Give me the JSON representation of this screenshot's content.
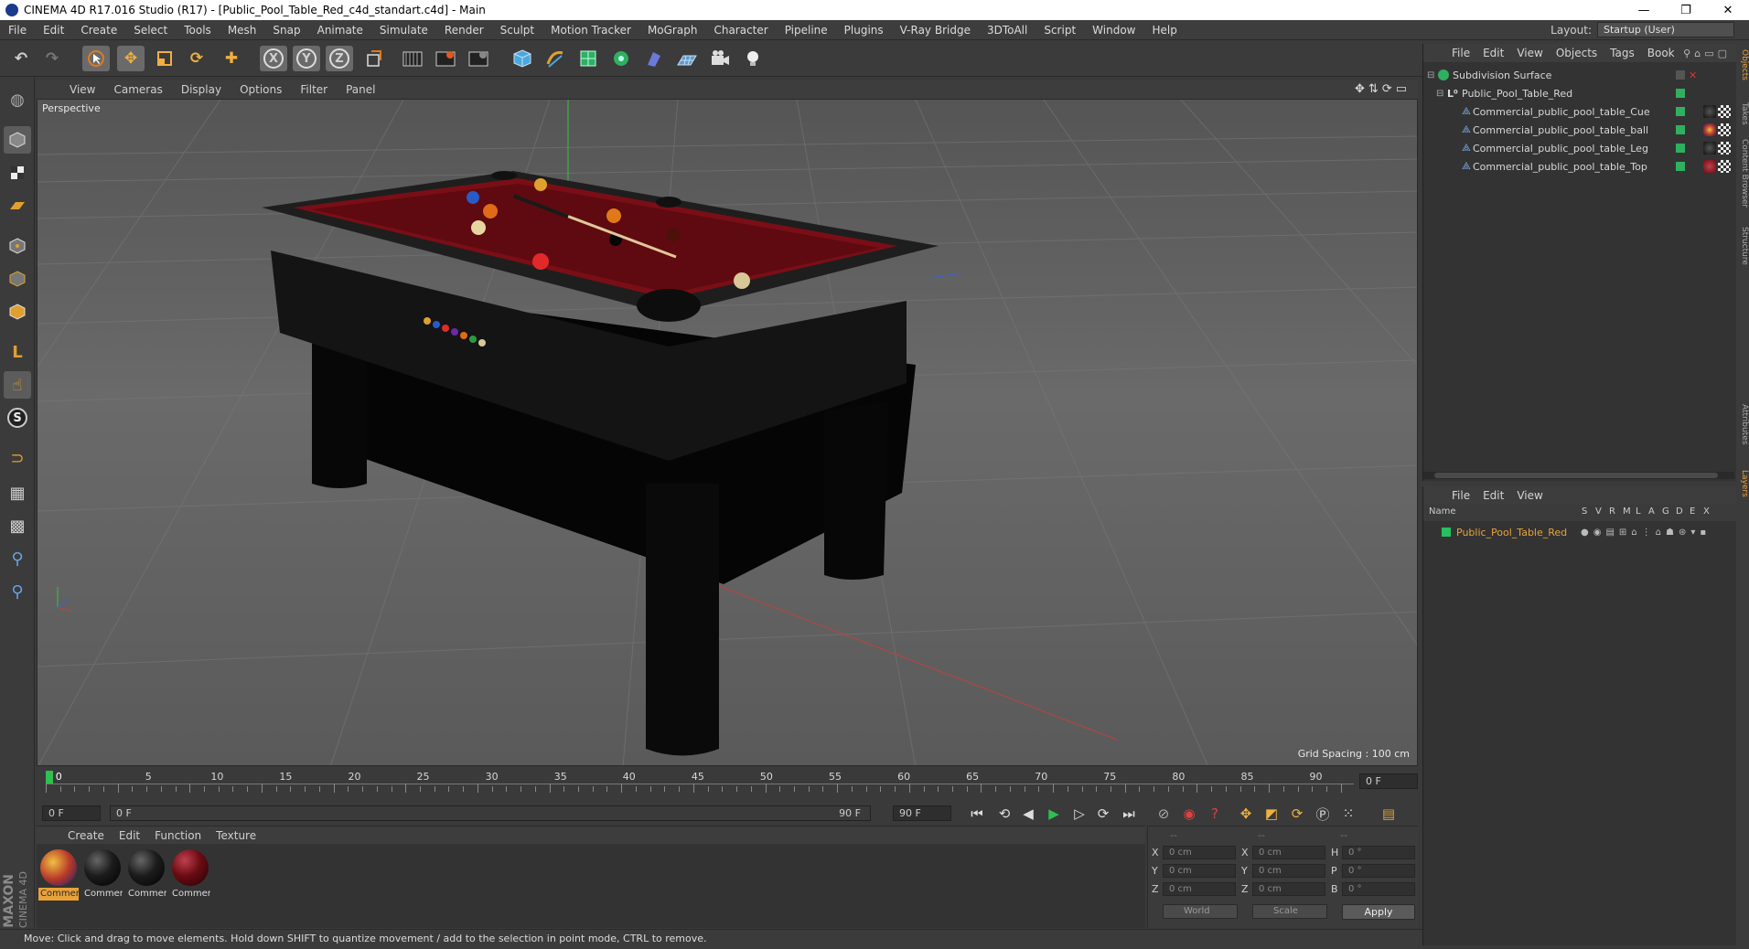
{
  "window": {
    "title": "CINEMA 4D R17.016 Studio (R17) - [Public_Pool_Table_Red_c4d_standart.c4d] - Main",
    "minimize": "—",
    "restore": "❐",
    "close": "✕"
  },
  "menubar": {
    "items": [
      "File",
      "Edit",
      "Create",
      "Select",
      "Tools",
      "Mesh",
      "Snap",
      "Animate",
      "Simulate",
      "Render",
      "Sculpt",
      "Motion Tracker",
      "MoGraph",
      "Character",
      "Pipeline",
      "Plugins",
      "V-Ray Bridge",
      "3DToAll",
      "Script",
      "Window",
      "Help"
    ],
    "layout_label": "Layout:",
    "layout_value": "Startup (User)"
  },
  "toolbar": {
    "icons": [
      "undo-icon",
      "redo-icon",
      "select-icon",
      "move-icon",
      "scale-icon",
      "rotate-icon",
      "move-axis-icon",
      "x-axis-icon",
      "y-axis-icon",
      "z-axis-icon",
      "world-coord-icon",
      "render-view-icon",
      "render-pic-icon",
      "render-settings-icon",
      "cube-icon",
      "pen-icon",
      "subdivision-icon",
      "array-icon",
      "deformer-icon",
      "floor-icon",
      "camera-icon",
      "light-icon"
    ],
    "axis_labels": [
      "X",
      "Y",
      "Z"
    ]
  },
  "viewport": {
    "menu": [
      "View",
      "Cameras",
      "Display",
      "Options",
      "Filter",
      "Panel"
    ],
    "label": "Perspective",
    "grid_spacing": "Grid Spacing : 100 cm"
  },
  "timeline": {
    "ticks": [
      "0",
      "5",
      "10",
      "15",
      "20",
      "25",
      "30",
      "35",
      "40",
      "45",
      "50",
      "55",
      "60",
      "65",
      "70",
      "75",
      "80",
      "85",
      "90"
    ],
    "current_frame": "0 F",
    "start_field": "0 F",
    "range_start": "0 F",
    "range_end": "90 F",
    "end_field": "90 F"
  },
  "materials": {
    "menu": [
      "Create",
      "Edit",
      "Function",
      "Texture"
    ],
    "items": [
      {
        "label": "Commer",
        "color": "#b83a2a",
        "active": true
      },
      {
        "label": "Commer",
        "color": "#1c1c1c",
        "active": false
      },
      {
        "label": "Commer",
        "color": "#1c1c1c",
        "active": false
      },
      {
        "label": "Commer",
        "color": "#6a0c12",
        "active": false
      }
    ]
  },
  "coords": {
    "header": [
      "--",
      "--",
      "--"
    ],
    "rows": [
      {
        "a": "X",
        "av": "0 cm",
        "b": "X",
        "bv": "0 cm",
        "c": "H",
        "cv": "0 °"
      },
      {
        "a": "Y",
        "av": "0 cm",
        "b": "Y",
        "bv": "0 cm",
        "c": "P",
        "cv": "0 °"
      },
      {
        "a": "Z",
        "av": "0 cm",
        "b": "Z",
        "bv": "0 cm",
        "c": "B",
        "cv": "0 °"
      }
    ],
    "mode": "World",
    "scale": "Scale",
    "apply": "Apply"
  },
  "status": "Move: Click and drag to move elements. Hold down SHIFT to quantize movement / add to the selection in point mode, CTRL to remove.",
  "object_manager": {
    "menu": [
      "File",
      "Edit",
      "View",
      "Objects",
      "Tags",
      "Book"
    ],
    "objects": [
      {
        "name": "Subdivision Surface",
        "indent": 0
      },
      {
        "name": "Public_Pool_Table_Red",
        "indent": 1
      },
      {
        "name": "Commercial_public_pool_table_Cue",
        "indent": 2
      },
      {
        "name": "Commercial_public_pool_table_ball",
        "indent": 2
      },
      {
        "name": "Commercial_public_pool_table_Leg",
        "indent": 2
      },
      {
        "name": "Commercial_public_pool_table_Top",
        "indent": 2
      }
    ]
  },
  "layer_manager": {
    "menu": [
      "File",
      "Edit",
      "View"
    ],
    "columns": [
      "Name",
      "S",
      "V",
      "R",
      "M",
      "L",
      "A",
      "G",
      "D",
      "E",
      "X"
    ],
    "layers": [
      {
        "name": "Public_Pool_Table_Red",
        "color": "#26c060"
      }
    ]
  },
  "side_tabs": [
    "Objects",
    "Takes",
    "Content Browser",
    "Structure",
    "Attributes",
    "Layers"
  ],
  "logo": {
    "line1": "MAXON",
    "line2": "CINEMA 4D"
  },
  "colors": {
    "accent": "#e8a23a",
    "felt": "#7a0e16",
    "green_tag": "#26c060"
  }
}
